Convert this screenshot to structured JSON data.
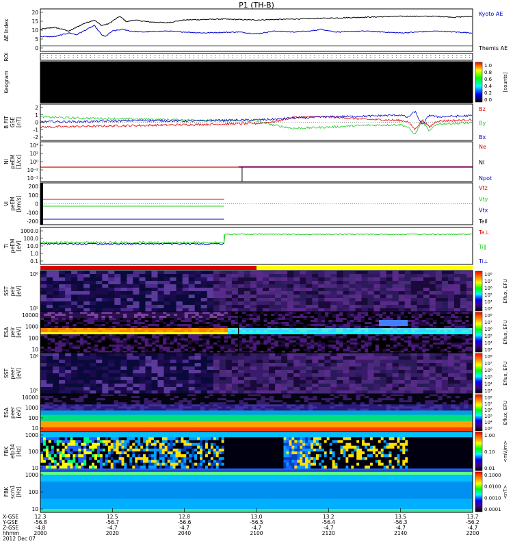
{
  "title": "P1 (TH-B)",
  "colors": {
    "black": "#000000",
    "red": "#e00000",
    "green": "#22cc22",
    "blue": "#0000cc",
    "yellow": "#ffff00",
    "orange": "#ff8000",
    "cyan": "#00e0ff",
    "purple": "#5a2a8a",
    "navy": "#0a0a7a",
    "magenta": "#7a2a9a",
    "teal": "#20c0b0"
  },
  "chart_data": {
    "type": "line",
    "x_ticks": {
      "xgse": [
        "12.3",
        "12.5",
        "12.8",
        "13.0",
        "13.2",
        "13.5",
        "13.7"
      ],
      "ygse": [
        "-56.8",
        "-56.7",
        "-56.6",
        "-56.5",
        "-56.4",
        "-56.3",
        "-56.2"
      ],
      "zgse": [
        "-4.8",
        "-4.7",
        "-4.7",
        "-4.7",
        "-4.7",
        "-4.7",
        "-4.7"
      ],
      "hhmm": [
        "2000",
        "2020",
        "2040",
        "2100",
        "2120",
        "2140",
        "2200"
      ]
    },
    "x_row_labels": [
      "X-GSE",
      "Y-GSE",
      "Z-GSE",
      "hhmm",
      "2012 Dec 07"
    ],
    "x_range": [
      0,
      120
    ],
    "panels": [
      {
        "id": "ae",
        "ylabel": "AE Index",
        "ylim": [
          -3,
          20
        ],
        "ticks": [
          "20",
          "15",
          "10",
          "5",
          "0"
        ],
        "right_labels": [
          {
            "text": "Kyoto AE",
            "color": "#0000cc"
          },
          {
            "text": "Themis AE",
            "color": "#000000"
          }
        ],
        "series": [
          {
            "name": "Kyoto AE",
            "color": "#000000",
            "x": [
              0,
              4,
              8,
              12,
              15,
              17,
              19,
              22,
              24,
              26,
              30,
              35,
              40,
              50,
              60,
              70,
              80,
              90,
              100,
              110,
              115,
              120
            ],
            "values": [
              9,
              10,
              8,
              12,
              14,
              11,
              12,
              16,
              13,
              14,
              13,
              12.5,
              14,
              14.5,
              14,
              14.5,
              15,
              15.5,
              16,
              16,
              15.5,
              16
            ]
          },
          {
            "name": "Themis AE",
            "color": "#0000cc",
            "x": [
              0,
              4,
              8,
              10,
              12,
              14,
              15,
              17,
              18,
              20,
              23,
              25,
              28,
              35,
              45,
              55,
              60,
              65,
              70,
              75,
              78,
              82,
              90,
              100,
              110,
              120
            ],
            "values": [
              5,
              5,
              7,
              6,
              8,
              10,
              11,
              6,
              5,
              8,
              9,
              8,
              7.5,
              8,
              7,
              7.5,
              6.5,
              8,
              7.5,
              8,
              9,
              7.5,
              8,
              7,
              8,
              7
            ]
          }
        ]
      },
      {
        "id": "roi",
        "ylabel": "ROI"
      },
      {
        "id": "keogram",
        "ylabel": "Keogram",
        "colorbar": {
          "ticks": [
            "1.0",
            "0.8",
            "0.6",
            "0.4",
            "0.2",
            "0.0"
          ],
          "label": "[counts]"
        }
      },
      {
        "id": "bfield",
        "ylabel": "B FIT",
        "sublabel": "GSE",
        "unit": "[nT]",
        "ylim": [
          -3,
          3
        ],
        "ticks": [
          "2",
          "1",
          "0",
          "-1",
          "-2"
        ],
        "right_labels": [
          {
            "text": "Bz",
            "color": "#e00000"
          },
          {
            "text": "By",
            "color": "#22cc22"
          },
          {
            "text": "Bx",
            "color": "#0000cc"
          }
        ],
        "series": [
          {
            "name": "Bz",
            "color": "#e00000",
            "x": [
              0,
              10,
              20,
              30,
              40,
              50,
              60,
              65,
              70,
              75,
              80,
              90,
              100,
              102,
              104,
              106,
              108,
              110,
              115,
              120
            ],
            "values": [
              -0.8,
              -0.7,
              -0.6,
              -0.5,
              -0.4,
              -0.3,
              -0.2,
              0.1,
              0.8,
              0.9,
              0.9,
              0.5,
              0.3,
              0.1,
              -1.2,
              0.4,
              -0.8,
              0.2,
              0.3,
              0.4
            ]
          },
          {
            "name": "By",
            "color": "#22cc22",
            "x": [
              0,
              10,
              20,
              30,
              40,
              50,
              60,
              65,
              70,
              75,
              80,
              90,
              100,
              102,
              104,
              106,
              108,
              110,
              115,
              120
            ],
            "values": [
              0.9,
              0.7,
              0.6,
              0.5,
              0.4,
              0.3,
              0.2,
              -0.5,
              -1.0,
              -0.9,
              -0.8,
              -0.5,
              -0.4,
              -0.8,
              -2.0,
              0.2,
              -1.5,
              -0.3,
              -0.2,
              -0.1
            ]
          },
          {
            "name": "Bx",
            "color": "#0000cc",
            "x": [
              0,
              10,
              20,
              30,
              40,
              50,
              60,
              65,
              70,
              75,
              80,
              90,
              100,
              102,
              104,
              106,
              108,
              110,
              115,
              120
            ],
            "values": [
              0.1,
              0.1,
              0.2,
              0.3,
              0.2,
              0.3,
              0.4,
              0.5,
              0.7,
              0.8,
              0.9,
              1.0,
              1.2,
              0.8,
              1.8,
              -0.5,
              1.2,
              0.9,
              1.0,
              1.1
            ]
          }
        ]
      },
      {
        "id": "density",
        "ylabel": "NI",
        "sublabel": "peEM",
        "unit": "[1/cc]",
        "ticks": [
          "10⁴",
          "10²",
          "10⁰",
          "10⁻²",
          "10⁻³"
        ],
        "right_labels": [
          {
            "text": "Ne",
            "color": "#e00000"
          },
          {
            "text": "NI",
            "color": "#000000"
          },
          {
            "text": "Npot",
            "color": "#0000cc"
          }
        ]
      },
      {
        "id": "velocity",
        "ylabel": "Vi",
        "sublabel": "peEM",
        "unit": "[km/s]",
        "ylim": [
          -300,
          300
        ],
        "ticks": [
          "200",
          "100",
          "0",
          "-100",
          "-200"
        ],
        "right_labels": [
          {
            "text": "Vtz",
            "color": "#e00000"
          },
          {
            "text": "Vty",
            "color": "#22cc22"
          },
          {
            "text": "Vtx",
            "color": "#0000cc"
          },
          {
            "text": "Tell",
            "color": "#000000"
          }
        ]
      },
      {
        "id": "temperature",
        "ylabel": "Ti",
        "sublabel": "peEM",
        "unit": "[eV]",
        "ticks": [
          "1000.0",
          "100.0",
          "10.0",
          "1.0",
          "0.1"
        ],
        "right_labels": [
          {
            "text": "Te⊥",
            "color": "#e00000"
          },
          {
            "text": "Ti∥",
            "color": "#22cc22"
          },
          {
            "text": "Ti⊥",
            "color": "#0000cc"
          }
        ]
      },
      {
        "id": "sst_ion",
        "ylabel": "SST",
        "sublabel": "peir",
        "unit": "[eV]",
        "ticks": [
          "10⁶",
          "10⁵"
        ],
        "colorbar": {
          "ticks": [
            "10⁸",
            "10⁷",
            "10⁶",
            "10⁵",
            "10⁴",
            "10³"
          ],
          "label": "Eflux, EFU"
        }
      },
      {
        "id": "esa_ion",
        "ylabel": "ESA",
        "sublabel": "peir",
        "unit": "[eV]",
        "ticks": [
          "10000",
          "1000",
          "100",
          "10"
        ],
        "colorbar": {
          "ticks": [
            "10⁸",
            "10⁷",
            "10⁶",
            "10⁵",
            "10⁴",
            "10³"
          ],
          "label": "Eflux, EFU"
        }
      },
      {
        "id": "sst_elec",
        "ylabel": "SST",
        "sublabel": "peer",
        "unit": "[eV]",
        "ticks": [
          "10⁶",
          "10⁵"
        ],
        "colorbar": {
          "ticks": [
            "10⁸",
            "10⁷",
            "10⁶",
            "10⁵",
            "10⁴",
            "10³"
          ],
          "label": "Eflux, EFU"
        }
      },
      {
        "id": "esa_elec",
        "ylabel": "ESA",
        "sublabel": "peer",
        "unit": "[eV]",
        "ticks": [
          "10000",
          "1000",
          "100",
          "10"
        ],
        "colorbar": {
          "ticks": [
            "10⁸",
            "10⁷",
            "10⁶",
            "10⁵",
            "10⁴",
            "10³"
          ],
          "label": "Eflux, EFU"
        }
      },
      {
        "id": "fbk_e",
        "ylabel": "FBK",
        "sublabel": "efp34",
        "unit": "[Hz]",
        "ticks": [
          "1000",
          "100",
          "10"
        ],
        "colorbar": {
          "ticks": [
            "1.00",
            "0.10",
            "0.01"
          ],
          "label": "<mV/m>"
        }
      },
      {
        "id": "fbk_b",
        "ylabel": "FBK",
        "sublabel": "scm1",
        "unit": "[Hz]",
        "ticks": [
          "1000",
          "100",
          "10"
        ],
        "colorbar": {
          "ticks": [
            "0.1000",
            "0.0100",
            "0.0010",
            "0.0001"
          ],
          "label": "<nT>"
        }
      }
    ]
  }
}
